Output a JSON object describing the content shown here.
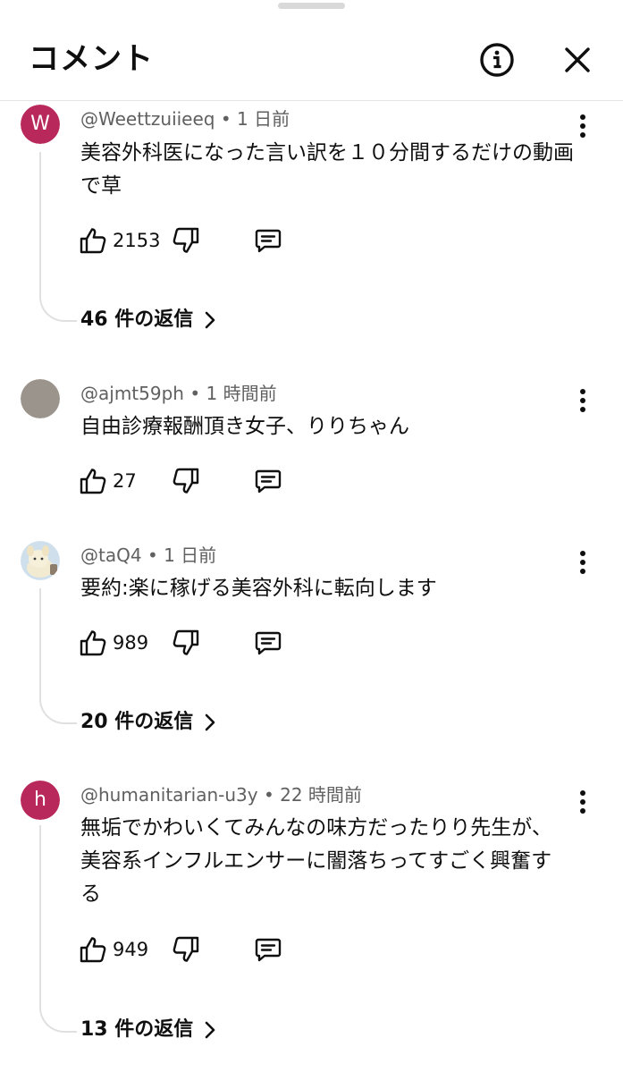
{
  "header": {
    "title": "コメント",
    "info_icon": "info-circle-icon",
    "close_icon": "close-icon"
  },
  "comments": [
    {
      "avatar_letter": "W",
      "avatar_color": "#b8285a",
      "author": "@Weettzuiieeq",
      "time": "1 日前",
      "text": "美容外科医になった言い訳を１０分間するだけの動画で草",
      "likes": "2153",
      "replies": "46 件の返信"
    },
    {
      "avatar_letter": "",
      "avatar_color": "#9a948c",
      "author": "@ajmt59ph",
      "time": "1 時間前",
      "text": "自由診療報酬頂き女子、りりちゃん",
      "likes": "27",
      "replies": ""
    },
    {
      "avatar_letter": "",
      "avatar_color": "#cfe0ec",
      "author": "@taQ4",
      "time": "1 日前",
      "text": "要約:楽に稼げる美容外科に転向します",
      "likes": "989",
      "replies": "20 件の返信"
    },
    {
      "avatar_letter": "h",
      "avatar_color": "#b8285a",
      "author": "@humanitarian-u3y",
      "time": "22 時間前",
      "text": "無垢でかわいくてみんなの味方だったりり先生が、美容系インフルエンサーに闇落ちってすごく興奮する",
      "likes": "949",
      "replies": "13 件の返信"
    }
  ]
}
